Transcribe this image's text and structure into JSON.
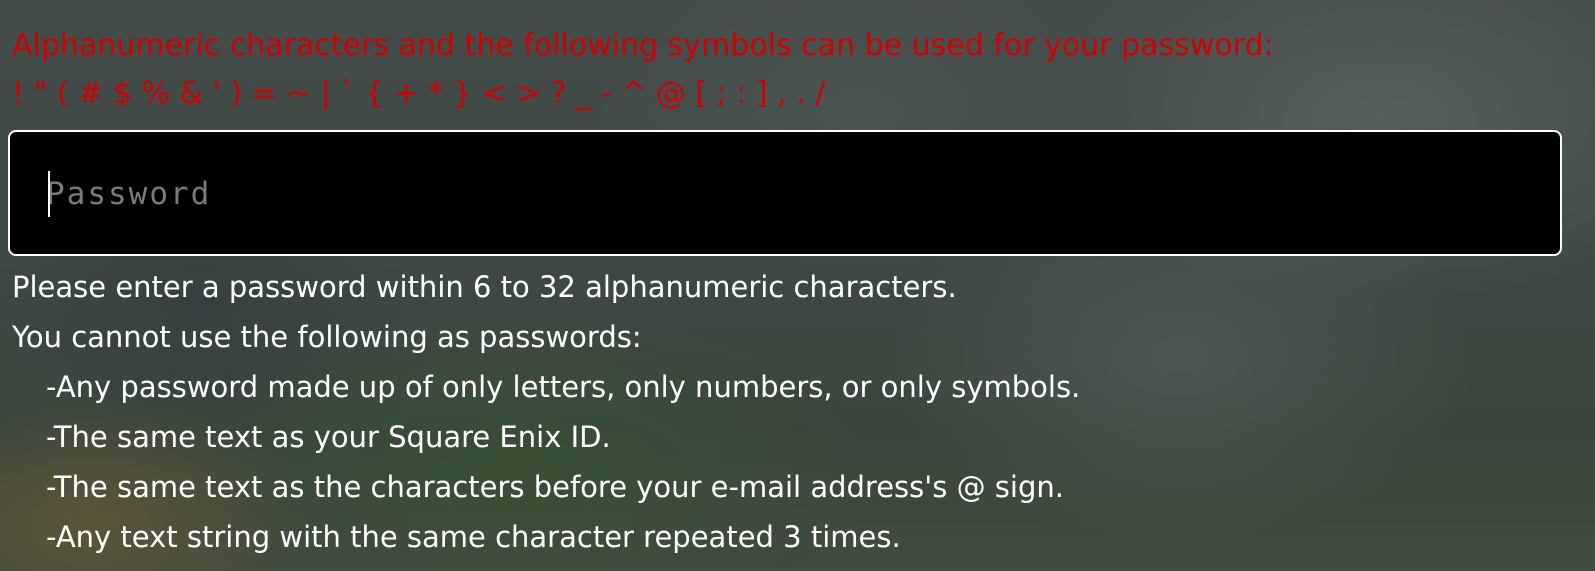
{
  "notice": {
    "line1": "Alphanumeric characters and the following symbols can be used for your password:",
    "line2": "! \" ( # $ % & ' ) = ~ | ` { + * } < > ? _ - ^ @ [ ; : ] , . /",
    "color": "#d20000"
  },
  "password": {
    "placeholder": "Password",
    "value": ""
  },
  "rules": {
    "length": "Please enter a password within 6 to 32 alphanumeric characters.",
    "cannot_use_heading": "You cannot use the following as passwords:",
    "items": [
      "-Any password made up of only letters, only numbers, or only symbols.",
      "-The same text as your Square Enix ID.",
      "-The same text as the characters before your e-mail address's @ sign.",
      "-Any text string with the same character repeated 3 times."
    ]
  }
}
